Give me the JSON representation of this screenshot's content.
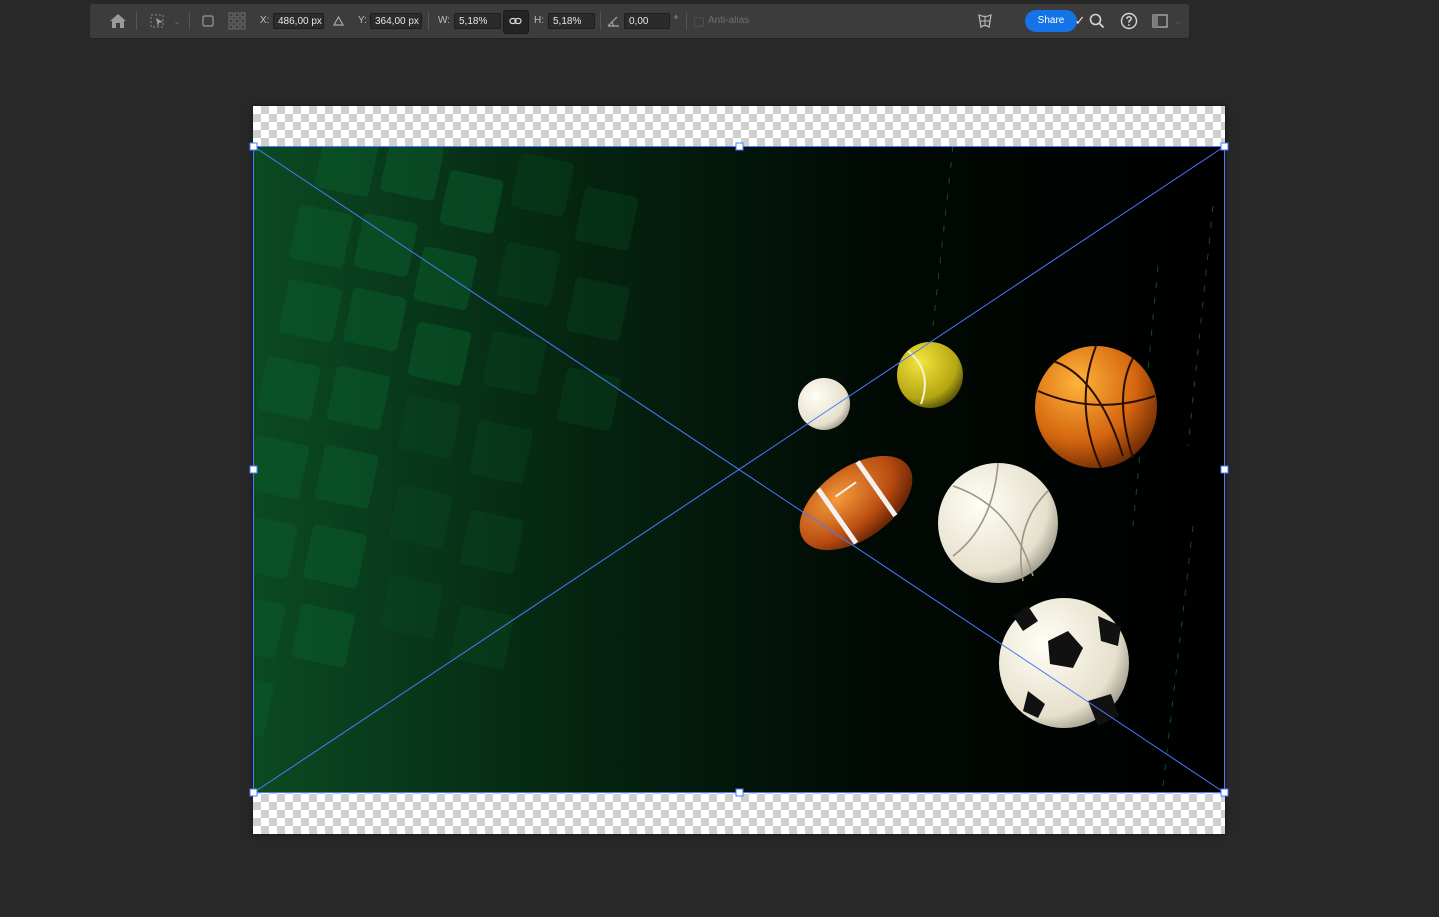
{
  "toolbar": {
    "x_label": "X:",
    "x_value": "486,00 px",
    "y_label": "Y:",
    "y_value": "364,00 px",
    "w_label": "W:",
    "w_value": "5,18%",
    "h_label": "H:",
    "h_value": "5,18%",
    "angle_value": "0,00",
    "angle_unit": "°",
    "antialias_label": "Anti-alias",
    "share_label": "Share"
  },
  "icons": {
    "home": "home-icon",
    "move_transform": "transform-icon",
    "reference_point": "reference-point-icon",
    "link": "link-icon",
    "angle": "angle-icon",
    "warp": "warp-icon",
    "search": "search-icon",
    "help": "help-icon",
    "workspace": "workspace-icon"
  },
  "colors": {
    "accent": "#1473e6",
    "transform_line": "#4a7bff",
    "background": "#282828",
    "toolbar": "#3c3c3c"
  }
}
